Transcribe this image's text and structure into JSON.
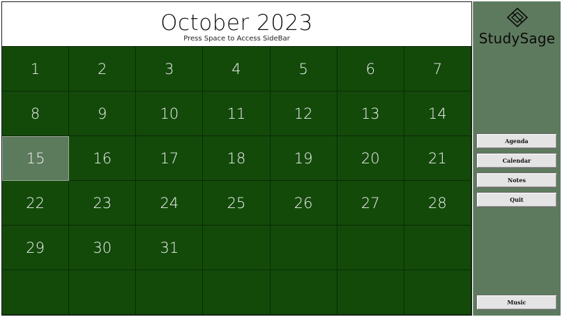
{
  "header": {
    "title": "October 2023",
    "hint": "Press Space to Access SideBar"
  },
  "calendar": {
    "selected_day": "15",
    "days": [
      "1",
      "2",
      "3",
      "4",
      "5",
      "6",
      "7",
      "8",
      "9",
      "10",
      "11",
      "12",
      "13",
      "14",
      "15",
      "16",
      "17",
      "18",
      "19",
      "20",
      "21",
      "22",
      "23",
      "24",
      "25",
      "26",
      "27",
      "28",
      "29",
      "30",
      "31",
      "",
      "",
      "",
      "",
      "",
      "",
      "",
      "",
      "",
      "",
      ""
    ]
  },
  "sidebar": {
    "logo_text": "StudySage",
    "logo_icon": "diamond-logo-icon",
    "buttons": {
      "agenda": "Agenda",
      "calendar": "Calendar",
      "notes": "Notes",
      "quit": "Quit",
      "music": "Music"
    }
  },
  "colors": {
    "calendar_bg": "#134a0a",
    "selected_day_bg": "#5c7a5c",
    "sidebar_bg": "#5e7a5e",
    "button_bg": "#e4e4e4"
  }
}
